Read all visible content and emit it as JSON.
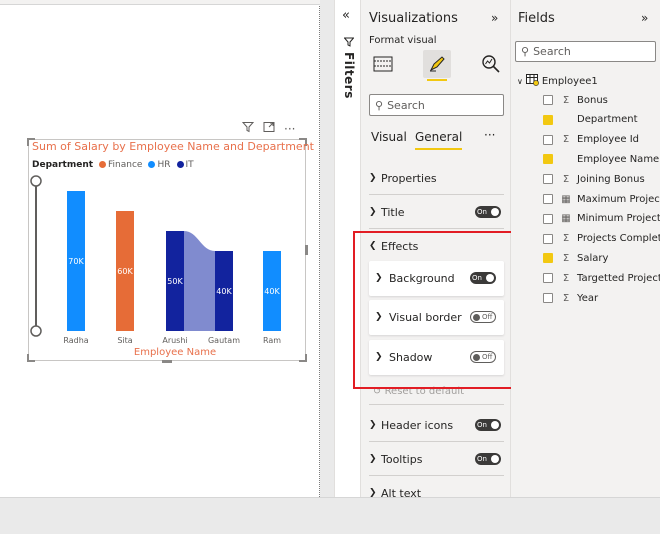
{
  "chart_data": {
    "type": "bar",
    "title": "Sum of Salary by Employee Name and Department",
    "xlabel": "Employee Name",
    "legend": {
      "title": "Department",
      "items": [
        {
          "name": "Finance",
          "color": "#e66c37"
        },
        {
          "name": "HR",
          "color": "#118dff"
        },
        {
          "name": "IT",
          "color": "#12239e"
        }
      ]
    },
    "categories": [
      "Radha",
      "Sita",
      "Arushi",
      "Gautam",
      "Ram"
    ],
    "bars": [
      {
        "category": "Radha",
        "series": "HR",
        "value": 70,
        "label": "70K"
      },
      {
        "category": "Sita",
        "series": "Finance",
        "value": 60,
        "label": "60K"
      },
      {
        "category": "Arushi",
        "series": "IT",
        "value": 50,
        "label": "50K"
      },
      {
        "category": "Gautam",
        "series": "IT",
        "value": 40,
        "label": "40K"
      },
      {
        "category": "Ram",
        "series": "HR",
        "value": 40,
        "label": "40K"
      }
    ],
    "ylim": [
      0,
      75
    ]
  },
  "colors": {
    "finance": "#e66c37",
    "hr": "#118dff",
    "it": "#12239e",
    "ribbon": "#6a77c7",
    "accent": "#f2c811",
    "highlight": "#e21d24"
  },
  "visual_tools": {
    "filter_icon": "funnel-icon",
    "focus_icon": "focus-mode-icon",
    "more_icon": "more-options-icon"
  },
  "filters": {
    "label": "Filters"
  },
  "visualizations": {
    "title": "Visualizations",
    "format_label": "Format visual",
    "search_placeholder": "Search",
    "tabs": {
      "visual": "Visual",
      "general": "General",
      "more": "···"
    },
    "sections": {
      "properties": "Properties",
      "title": "Title",
      "title_toggle": "On",
      "effects": "Effects",
      "background": "Background",
      "background_toggle": "On",
      "visual_border": "Visual border",
      "visual_border_toggle": "Off",
      "shadow": "Shadow",
      "shadow_toggle": "Off",
      "reset": "Reset to default",
      "header_icons": "Header icons",
      "header_icons_toggle": "On",
      "tooltips": "Tooltips",
      "tooltips_toggle": "On",
      "alt_text": "Alt text"
    }
  },
  "fields": {
    "title": "Fields",
    "search_placeholder": "Search",
    "table": "Employee1",
    "items": [
      {
        "name": "Bonus",
        "type": "Σ",
        "checked": false
      },
      {
        "name": "Department",
        "type": "",
        "checked": true
      },
      {
        "name": "Employee Id",
        "type": "Σ",
        "checked": false
      },
      {
        "name": "Employee Name",
        "type": "",
        "checked": true
      },
      {
        "name": "Joining Bonus",
        "type": "Σ",
        "checked": false
      },
      {
        "name": "Maximum Projects",
        "type": "▦",
        "checked": false
      },
      {
        "name": "Minimum Projects",
        "type": "▦",
        "checked": false
      },
      {
        "name": "Projects Complet...",
        "type": "Σ",
        "checked": false
      },
      {
        "name": "Salary",
        "type": "Σ",
        "checked": true
      },
      {
        "name": "Targetted Projects",
        "type": "Σ",
        "checked": false
      },
      {
        "name": "Year",
        "type": "Σ",
        "checked": false
      }
    ]
  }
}
